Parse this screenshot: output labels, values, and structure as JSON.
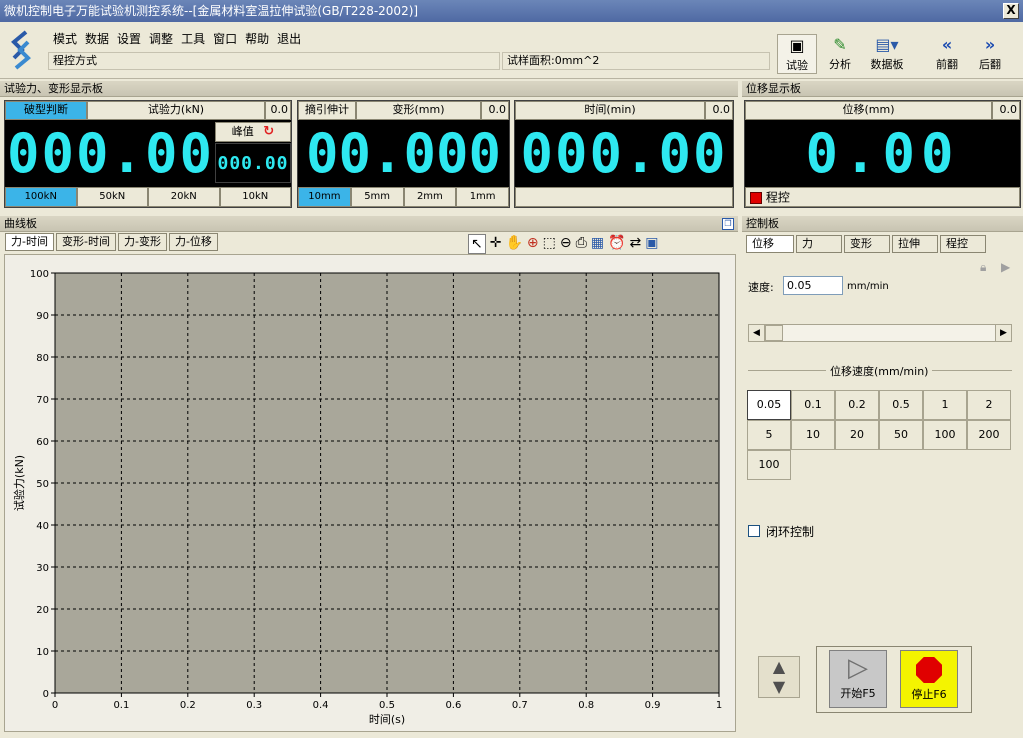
{
  "window": {
    "title": "微机控制电子万能试验机测控系统--[金属材料室温拉伸试验(GB/T228-2002)]",
    "close": "X"
  },
  "menu": {
    "items": [
      "模式",
      "数据",
      "设置",
      "调整",
      "工具",
      "窗口",
      "帮助",
      "退出"
    ]
  },
  "status": {
    "mode": "程控方式",
    "area": "试样面积:0mm^2"
  },
  "toolbar": [
    {
      "label": "试验",
      "icon": "test-icon"
    },
    {
      "label": "分析",
      "icon": "analysis-icon"
    },
    {
      "label": "数据板",
      "icon": "databoard-icon"
    },
    {
      "label": "前翻",
      "icon": "prev-icon"
    },
    {
      "label": "后翻",
      "icon": "next-icon"
    }
  ],
  "force_panel": {
    "header": "试验力、变形显示板",
    "break_btn": "破型判断",
    "force_label": "试验力(kN)",
    "force_small": "0.0",
    "force_value": "000.00",
    "peak_label": "峰值",
    "peak_value": "000.00",
    "force_ranges": [
      "100kN",
      "50kN",
      "20kN",
      "10kN"
    ],
    "extensometer_btn": "摘引伸计",
    "deform_label": "变形(mm)",
    "deform_small": "0.0",
    "deform_value": "00.000",
    "deform_ranges": [
      "10mm",
      "5mm",
      "2mm",
      "1mm"
    ],
    "time_label": "时间(min)",
    "time_small": "0.0",
    "time_value": "000.00"
  },
  "disp_panel": {
    "header": "位移显示板",
    "label": "位移(mm)",
    "small": "0.0",
    "value": "0.00",
    "control_label": "程控",
    "control_color": "#e00000"
  },
  "curve_panel": {
    "header": "曲线板",
    "tabs": [
      "力-时间",
      "变形-时间",
      "力-变形",
      "力-位移"
    ]
  },
  "chart_data": {
    "type": "line",
    "xlabel": "时间(s)",
    "ylabel": "试验力(kN)",
    "xlim": [
      0,
      1
    ],
    "ylim": [
      0,
      100
    ],
    "xticks": [
      "0",
      "0.1",
      "0.2",
      "0.3",
      "0.4",
      "0.5",
      "0.6",
      "0.7",
      "0.8",
      "0.9",
      "1"
    ],
    "yticks": [
      "0",
      "10",
      "20",
      "30",
      "40",
      "50",
      "60",
      "70",
      "80",
      "90",
      "100"
    ],
    "grid": true,
    "series": []
  },
  "control_panel": {
    "header": "控制板",
    "tabs": [
      "位移",
      "力",
      "变形",
      "拉伸",
      "程控"
    ],
    "speed_label": "速度:",
    "speed_value": "0.05",
    "speed_unit": "mm/min",
    "speed_group": "位移速度(mm/min)",
    "speeds": [
      "0.05",
      "0.1",
      "0.2",
      "0.5",
      "1",
      "2",
      "5",
      "10",
      "20",
      "50",
      "100",
      "200",
      "100"
    ],
    "closed_loop": "闭环控制",
    "start": "开始F5",
    "stop": "停止F6"
  }
}
